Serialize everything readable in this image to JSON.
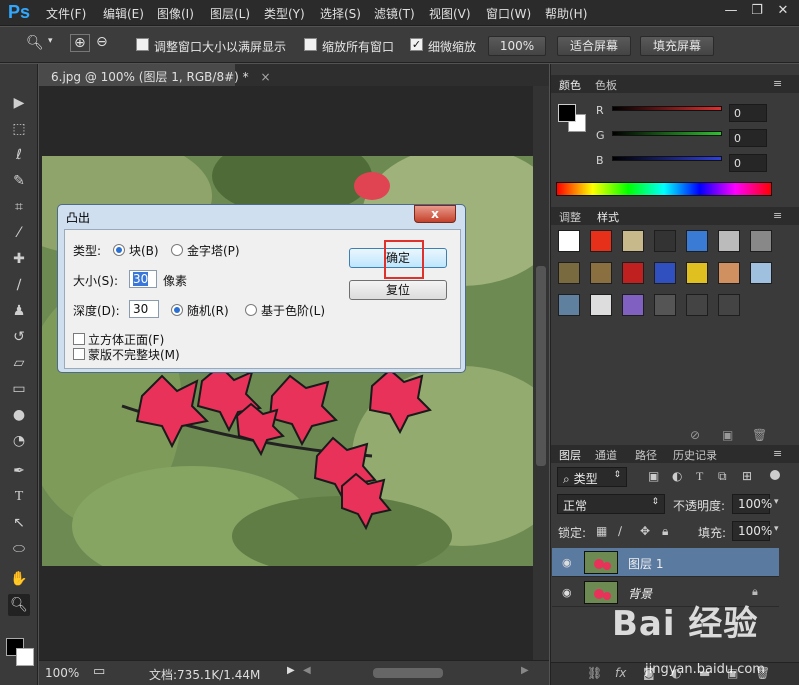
{
  "app": {
    "logo": "Ps",
    "menu": [
      "文件(F)",
      "编辑(E)",
      "图像(I)",
      "图层(L)",
      "类型(Y)",
      "选择(S)",
      "滤镜(T)",
      "视图(V)",
      "窗口(W)",
      "帮助(H)"
    ]
  },
  "options": {
    "resize_windows_label": "调整窗口大小以满屏显示",
    "zoom_all_windows_label": "缩放所有窗口",
    "scrubby_zoom_label": "细微缩放",
    "percent_button": "100%",
    "fit_screen_button": "适合屏幕",
    "fill_screen_button": "填充屏幕"
  },
  "document": {
    "tab_title": "6.jpg @ 100% (图层 1, RGB/8#) *",
    "zoom": "100%",
    "doc_info": "文档:735.1K/1.44M"
  },
  "dialog": {
    "title": "凸出",
    "close": "x",
    "type_label": "类型:",
    "type_block": "块(B)",
    "type_pyramid": "金字塔(P)",
    "size_label": "大小(S):",
    "size_value": "30",
    "size_unit": "像素",
    "depth_label": "深度(D):",
    "depth_value": "30",
    "depth_random": "随机(R)",
    "depth_level": "基于色阶(L)",
    "solid_front": "立方体正面(F)",
    "mask_incomplete": "蒙版不完整块(M)",
    "ok": "确定",
    "reset": "复位",
    "type_selected": "块(B)",
    "depth_selected": "随机(R)"
  },
  "color_panel": {
    "tabs": [
      "颜色",
      "色板"
    ],
    "channels": [
      {
        "label": "R",
        "value": "0",
        "color": "#e03030"
      },
      {
        "label": "G",
        "value": "0",
        "color": "#30c030"
      },
      {
        "label": "B",
        "value": "0",
        "color": "#3040e0"
      }
    ],
    "foreground": "#000000",
    "background": "#ffffff"
  },
  "styles_panel": {
    "tabs": [
      "调整",
      "样式"
    ]
  },
  "layers_panel": {
    "tabs": [
      "图层",
      "通道",
      "路径",
      "历史记录"
    ],
    "filter_kind": "类型",
    "blend_mode": "正常",
    "opacity_label": "不透明度:",
    "opacity_value": "100%",
    "lock_label": "锁定:",
    "fill_label": "填充:",
    "fill_value": "100%",
    "layers": [
      {
        "name": "图层 1",
        "selected": true
      },
      {
        "name": "背景",
        "selected": false
      }
    ]
  },
  "watermark": {
    "logo": "Bai 经验",
    "url": "jingyan.baidu.com"
  }
}
